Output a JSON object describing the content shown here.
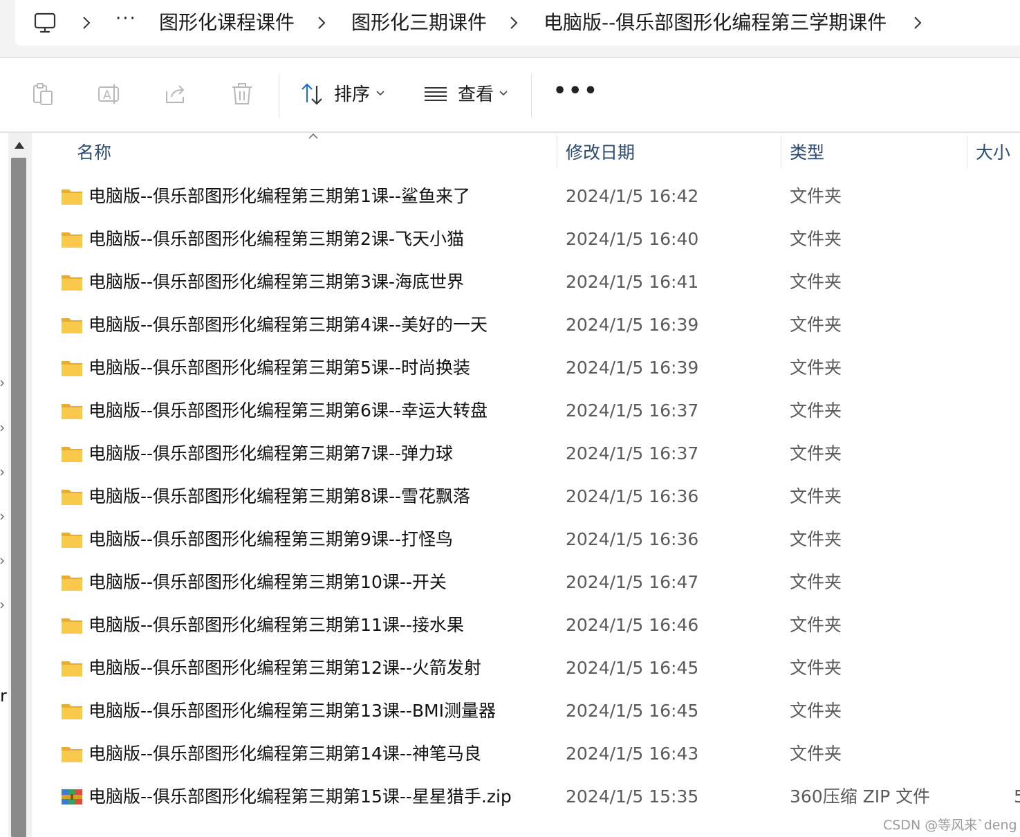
{
  "address_bar": {
    "overflow": "···",
    "crumbs": [
      "图形化课程课件",
      "图形化三期课件",
      "电脑版--俱乐部图形化编程第三学期课件"
    ]
  },
  "toolbar": {
    "sort_label": "排序",
    "view_label": "查看",
    "more": "•••"
  },
  "columns": {
    "name": "名称",
    "date": "修改日期",
    "type": "类型",
    "size": "大小"
  },
  "files": [
    {
      "name": "电脑版--俱乐部图形化编程第三期第1课--鲨鱼来了",
      "date": "2024/1/5 16:42",
      "type": "文件夹",
      "size": "",
      "icon": "folder-icon"
    },
    {
      "name": "电脑版--俱乐部图形化编程第三期第2课-飞天小猫",
      "date": "2024/1/5 16:40",
      "type": "文件夹",
      "size": "",
      "icon": "folder-icon"
    },
    {
      "name": "电脑版--俱乐部图形化编程第三期第3课-海底世界",
      "date": "2024/1/5 16:41",
      "type": "文件夹",
      "size": "",
      "icon": "folder-icon"
    },
    {
      "name": "电脑版--俱乐部图形化编程第三期第4课--美好的一天",
      "date": "2024/1/5 16:39",
      "type": "文件夹",
      "size": "",
      "icon": "folder-icon"
    },
    {
      "name": "电脑版--俱乐部图形化编程第三期第5课--时尚换装",
      "date": "2024/1/5 16:39",
      "type": "文件夹",
      "size": "",
      "icon": "folder-icon"
    },
    {
      "name": "电脑版--俱乐部图形化编程第三期第6课--幸运大转盘",
      "date": "2024/1/5 16:37",
      "type": "文件夹",
      "size": "",
      "icon": "folder-icon"
    },
    {
      "name": "电脑版--俱乐部图形化编程第三期第7课--弹力球",
      "date": "2024/1/5 16:37",
      "type": "文件夹",
      "size": "",
      "icon": "folder-icon"
    },
    {
      "name": "电脑版--俱乐部图形化编程第三期第8课--雪花飘落",
      "date": "2024/1/5 16:36",
      "type": "文件夹",
      "size": "",
      "icon": "folder-icon"
    },
    {
      "name": "电脑版--俱乐部图形化编程第三期第9课--打怪鸟",
      "date": "2024/1/5 16:36",
      "type": "文件夹",
      "size": "",
      "icon": "folder-icon"
    },
    {
      "name": "电脑版--俱乐部图形化编程第三期第10课--开关",
      "date": "2024/1/5 16:47",
      "type": "文件夹",
      "size": "",
      "icon": "folder-icon"
    },
    {
      "name": "电脑版--俱乐部图形化编程第三期第11课--接水果",
      "date": "2024/1/5 16:46",
      "type": "文件夹",
      "size": "",
      "icon": "folder-icon"
    },
    {
      "name": "电脑版--俱乐部图形化编程第三期第12课--火箭发射",
      "date": "2024/1/5 16:45",
      "type": "文件夹",
      "size": "",
      "icon": "folder-icon"
    },
    {
      "name": "电脑版--俱乐部图形化编程第三期第13课--BMI测量器",
      "date": "2024/1/5 16:45",
      "type": "文件夹",
      "size": "",
      "icon": "folder-icon"
    },
    {
      "name": "电脑版--俱乐部图形化编程第三期第14课--神笔马良",
      "date": "2024/1/5 16:43",
      "type": "文件夹",
      "size": "",
      "icon": "folder-icon"
    },
    {
      "name": "电脑版--俱乐部图形化编程第三期第15课--星星猎手.zip",
      "date": "2024/1/5 15:35",
      "type": "360压缩 ZIP 文件",
      "size": "5",
      "icon": "zip-archive-icon"
    }
  ],
  "nav_partial_text": "r",
  "watermark": "CSDN @等风来`deng",
  "colors": {
    "folder": "#f8c94a",
    "column_header": "#2b4a6f",
    "accent": "#1f6fd1"
  }
}
